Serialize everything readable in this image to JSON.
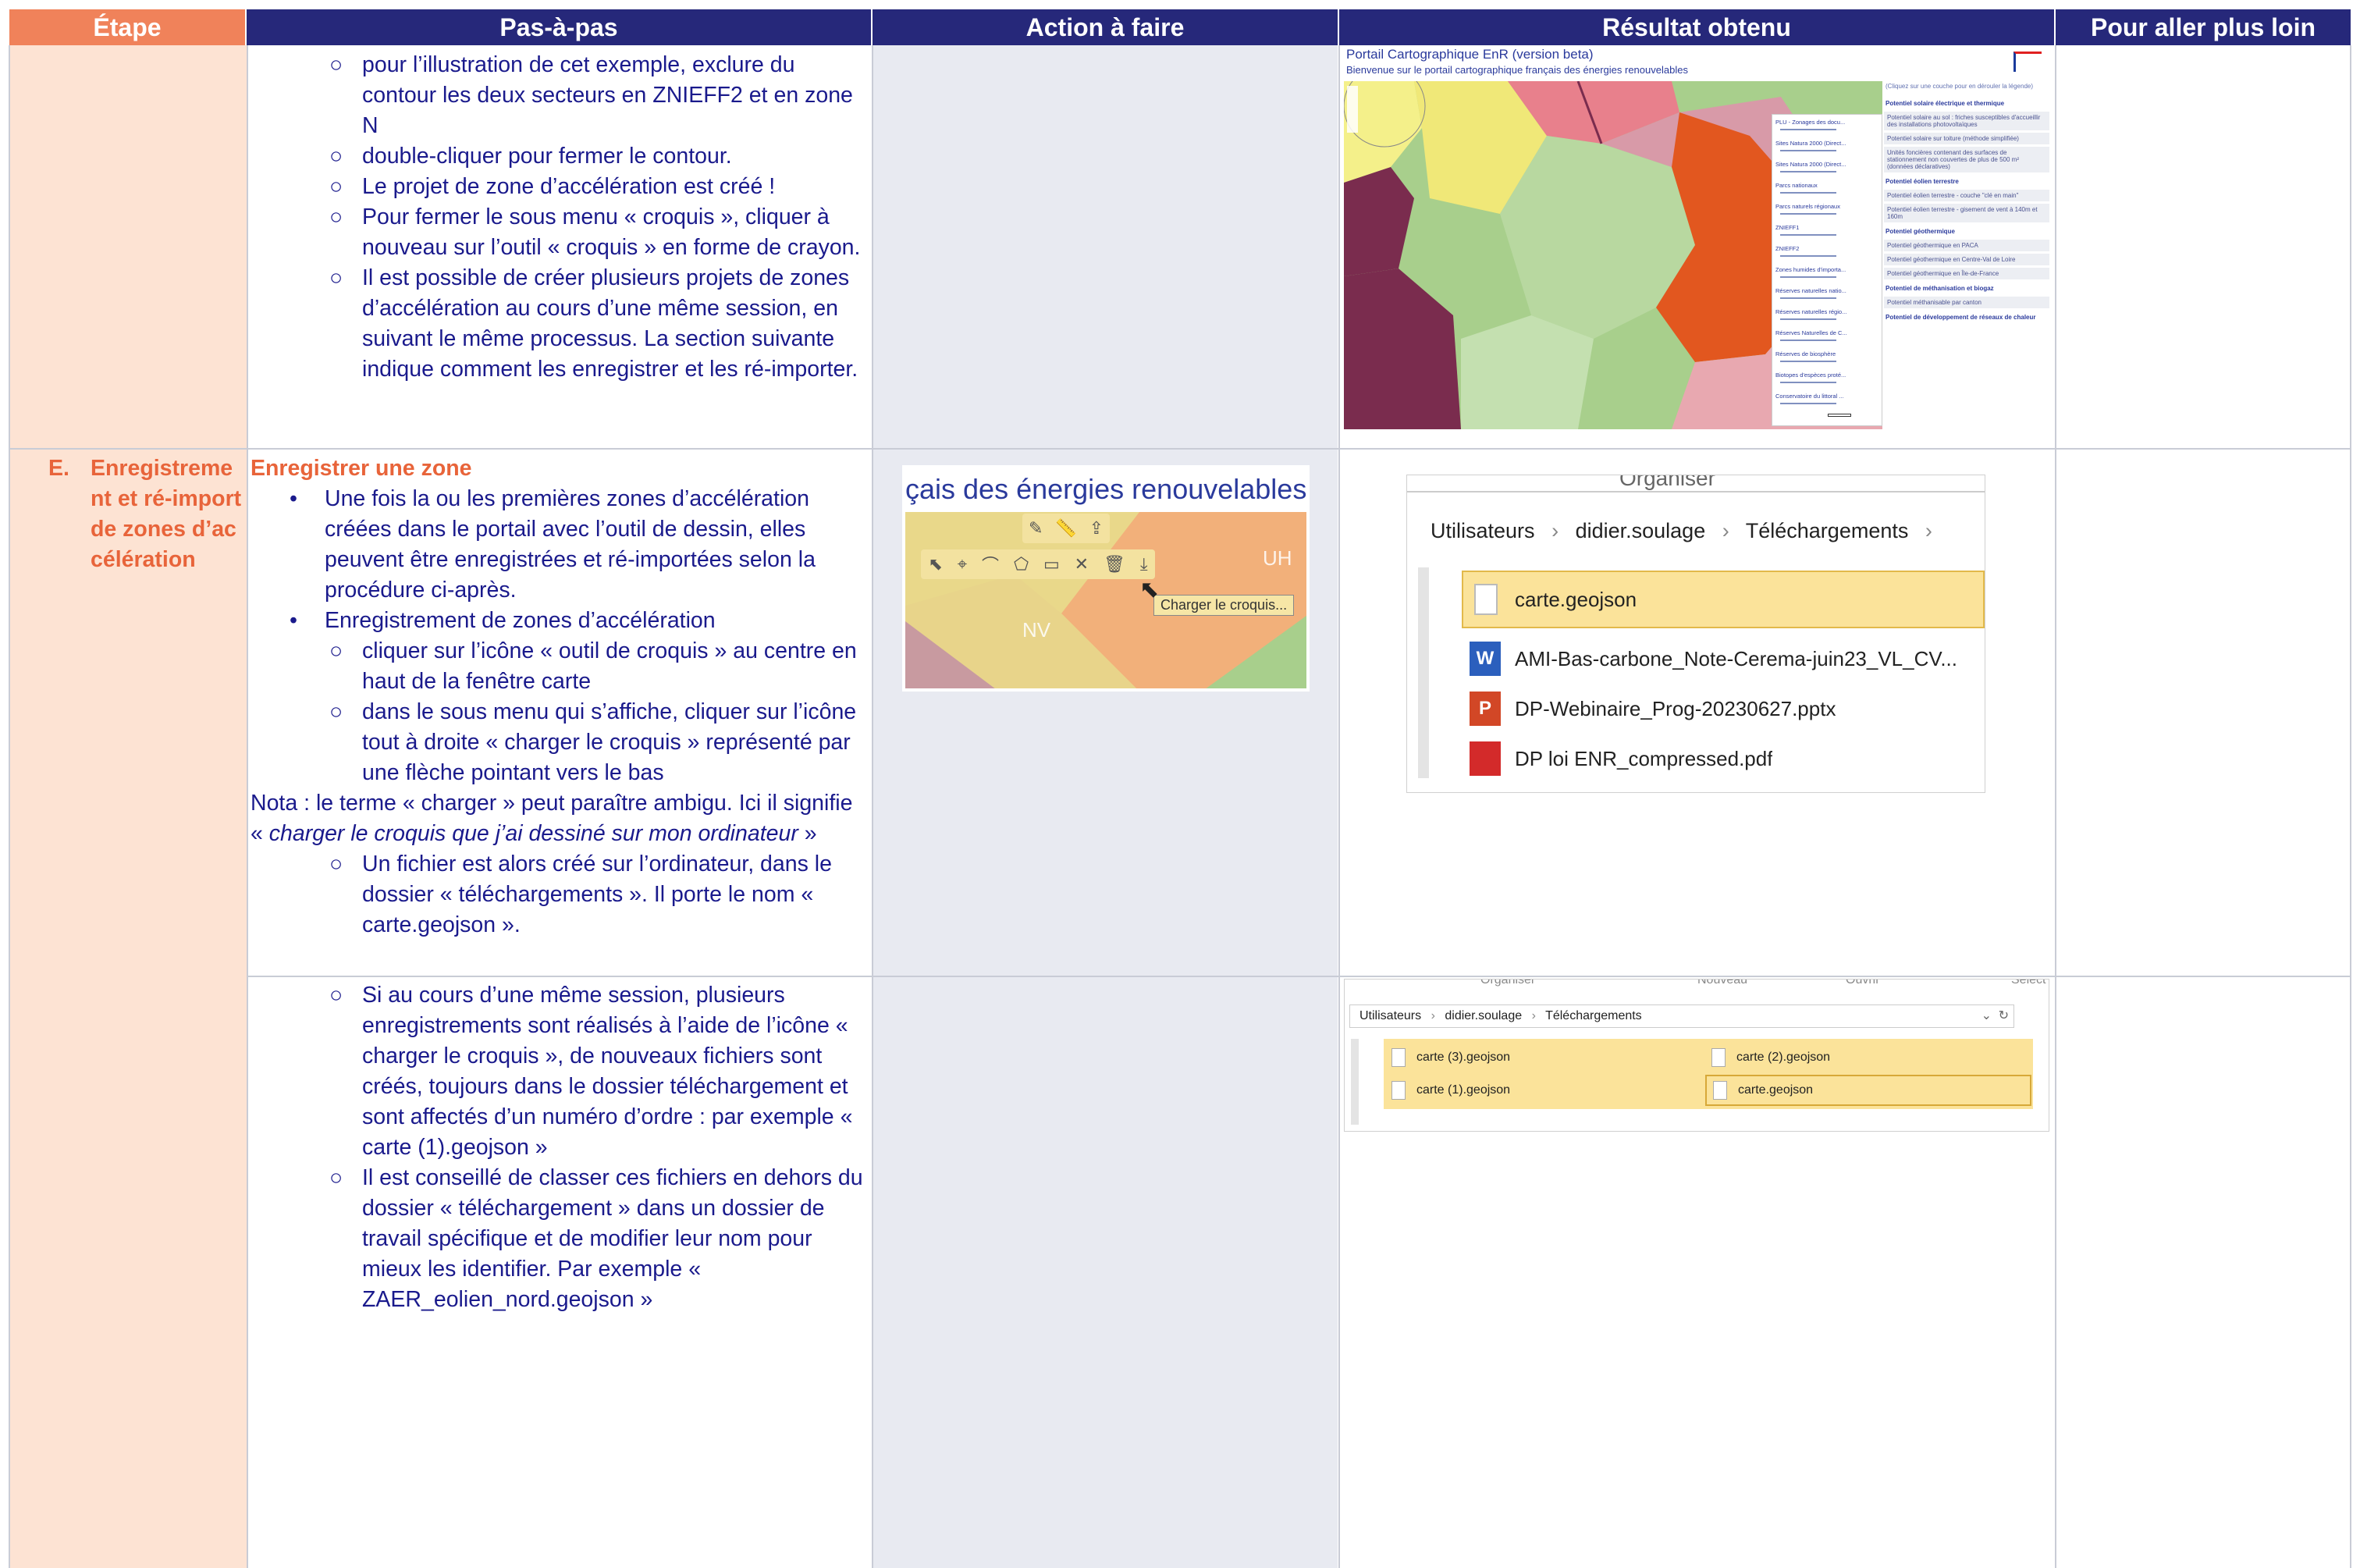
{
  "header": {
    "col_etape": "Étape",
    "col_pas": "Pas-à-pas",
    "col_action": "Action à faire",
    "col_resultat": "Résultat obtenu",
    "col_plus": "Pour aller plus loin"
  },
  "row1": {
    "items": [
      "pour l’illustration de cet exemple, exclure du contour les deux secteurs en ZNIEFF2 et en zone N",
      "double-cliquer pour fermer le contour.",
      "Le projet de zone d’accélération est créé !",
      "Pour fermer le sous menu « croquis », cliquer à nouveau sur l’outil « croquis » en forme de crayon.",
      "Il est possible de créer plusieurs projets de zones d’accélération au cours d’une même session, en suivant le même processus. La section suivante indique comment les enregistrer et les ré-importer."
    ],
    "map": {
      "title": "Portail Cartographique EnR (version beta)",
      "subtitle": "Bienvenue sur le portail cartographique français des énergies renouvelables",
      "layers": [
        "PLU - Zonages des docu...",
        "Sites Natura 2000 (Direct...",
        "Sites Natura 2000 (Direct...",
        "Parcs nationaux",
        "Parcs naturels régionaux",
        "ZNIEFF1",
        "ZNIEFF2",
        "Zones humides d'importa...",
        "Réserves naturelles natio...",
        "Réserves naturelles régio...",
        "Réserves Naturelles de C...",
        "Réserves de biosphère",
        "Biotopes d'espèces proté...",
        "Conservatoire du littoral ..."
      ],
      "legend_hint": "(Cliquez sur une couche pour en dérouler la légende)",
      "legend": [
        {
          "t": "Potentiel solaire électrique et thermique",
          "h": true
        },
        {
          "t": "Potentiel solaire au sol : friches susceptibles d'accueillir des installations photovoltaïques",
          "h": false
        },
        {
          "t": "Potentiel solaire sur toiture (méthode simplifiée)",
          "h": false
        },
        {
          "t": "Unités foncières contenant des surfaces de stationnement non couvertes de plus de 500 m² (données déclaratives)",
          "h": false
        },
        {
          "t": "Potentiel éolien terrestre",
          "h": true
        },
        {
          "t": "Potentiel éolien terrestre - couche \"clé en main\"",
          "h": false
        },
        {
          "t": "Potentiel éolien terrestre - gisement de vent à 140m et 160m",
          "h": false
        },
        {
          "t": "Potentiel géothermique",
          "h": true
        },
        {
          "t": "Potentiel géothermique en PACA",
          "h": false
        },
        {
          "t": "Potentiel géothermique en Centre-Val de Loire",
          "h": false
        },
        {
          "t": "Potentiel géothermique en Île-de-France",
          "h": false
        },
        {
          "t": "Potentiel de méthanisation et biogaz",
          "h": true
        },
        {
          "t": "Potentiel méthanisable par canton",
          "h": false
        },
        {
          "t": "Potentiel de développement de réseaux de chaleur",
          "h": true
        }
      ]
    }
  },
  "row2": {
    "etape_num": "E.",
    "etape_title": "Enregistrement et ré-import de zones d’accélération",
    "title": "Enregistrer une zone",
    "bullet1": "Une fois la ou les premières zones d’accélération créées dans le portail avec l’outil de dessin, elles peuvent être enregistrées et ré-importées selon la procédure ci-après.",
    "bullet2": "Enregistrement de zones d’accélération",
    "sub1": "cliquer sur l’icône « outil de croquis » au centre en haut de la fenêtre carte",
    "sub2": "dans le sous menu qui s’affiche, cliquer sur l’icône tout à droite « charger le croquis » représenté par une flèche pointant vers le bas",
    "nota_a": "Nota : le terme « charger » peut paraître ambigu. Ici il signifie « ",
    "nota_i": "charger le croquis que j’ai dessiné sur mon ordinateur",
    "nota_b": " »",
    "sub3": "Un fichier est alors créé sur l’ordinateur, dans le dossier « téléchargements ». Il porte le nom « carte.geojson ».",
    "shot": {
      "banner": "çais des énergies renouvelables",
      "tooltip": "Charger le croquis...",
      "label_uh": "UH",
      "label_nv": "NV"
    },
    "explorer": {
      "top": "Organiser",
      "crumbs": [
        "Utilisateurs",
        "didier.soulage",
        "Téléchargements"
      ],
      "files": [
        "carte.geojson",
        "AMI-Bas-carbone_Note-Cerema-juin23_VL_CV...",
        "DP-Webinaire_Prog-20230627.pptx",
        "DP loi ENR_compressed.pdf"
      ]
    }
  },
  "row3": {
    "sub4": "Si au cours d’une même session, plusieurs enregistrements sont réalisés à l’aide de l’icône « charger le croquis », de nouveaux fichiers sont créés, toujours dans le dossier téléchargement et sont affectés d’un numéro d’ordre : par exemple « carte (1).geojson »",
    "sub5": "Il est conseillé de classer ces fichiers en dehors du dossier « téléchargement » dans un dossier de travail spécifique et de modifier leur nom pour mieux les identifier. Par exemple « ZAER_eolien_nord.geojson »",
    "explorer": {
      "top": [
        "Organiser",
        "Nouveau",
        "Ouvrir",
        "Sélect"
      ],
      "crumbs": [
        "Utilisateurs",
        "didier.soulage",
        "Téléchargements"
      ],
      "files": [
        "carte (3).geojson",
        "carte (2).geojson",
        "carte (1).geojson",
        "carte.geojson"
      ]
    }
  }
}
